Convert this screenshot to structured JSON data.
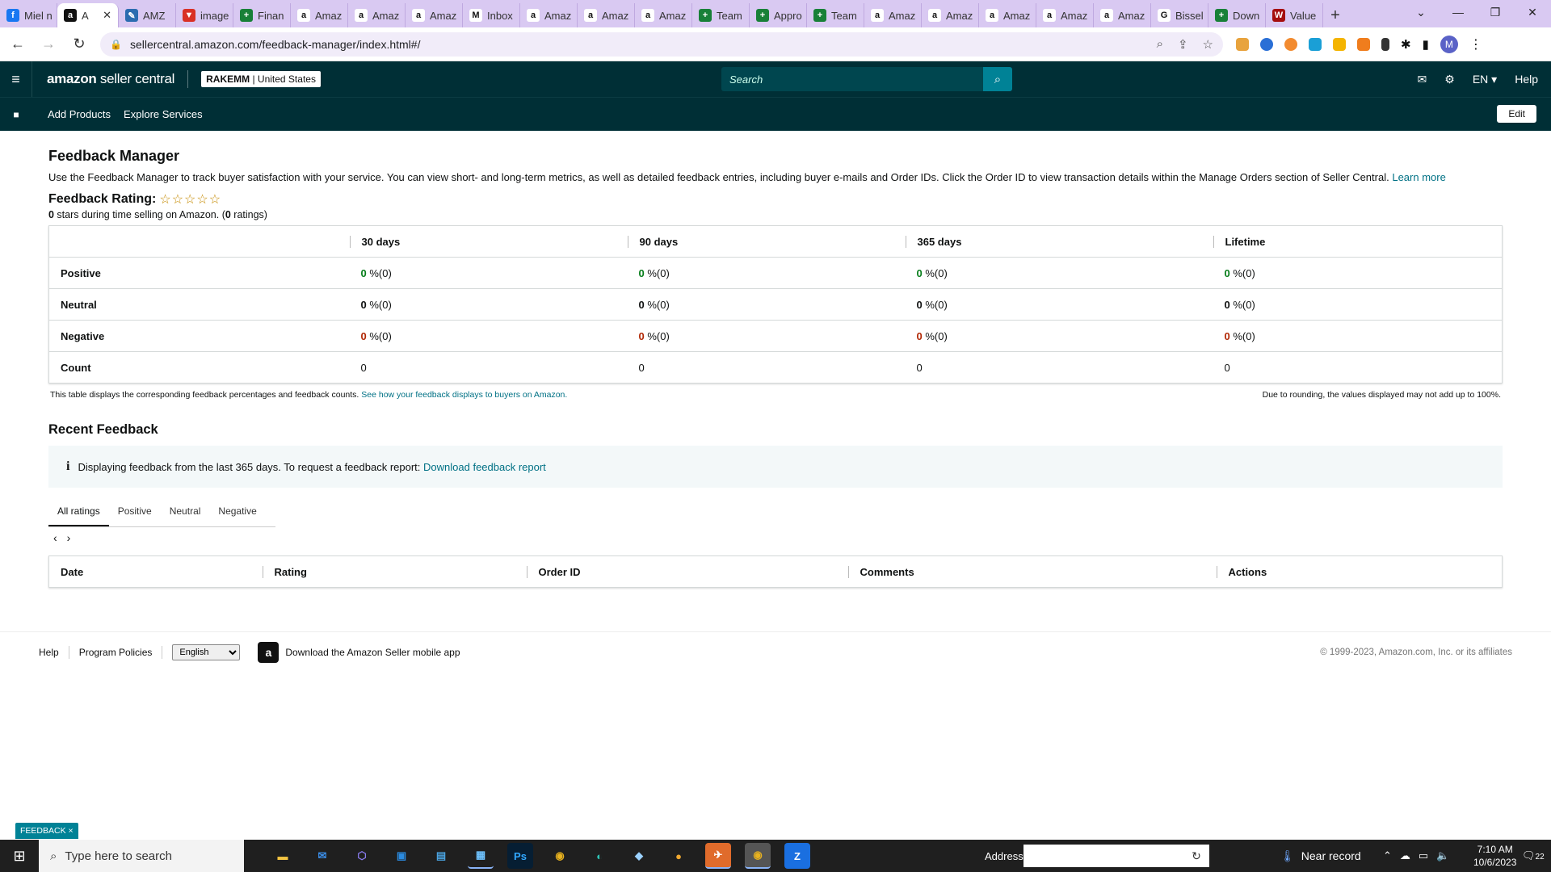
{
  "browser": {
    "tabs": [
      {
        "label": "Miel n",
        "color": "#1877f2",
        "glyph": "f",
        "active": false
      },
      {
        "label": "A",
        "color": "#111111",
        "glyph": "a",
        "active": true
      },
      {
        "label": "AMZ",
        "color": "#2b6cb0",
        "glyph": "✎",
        "active": false
      },
      {
        "label": "image",
        "color": "#d93025",
        "glyph": "▼",
        "active": false
      },
      {
        "label": "Finan",
        "color": "#188038",
        "glyph": "+",
        "active": false
      },
      {
        "label": "Amaz",
        "color": "#ffffff",
        "glyph": "a",
        "active": false
      },
      {
        "label": "Amaz",
        "color": "#ffffff",
        "glyph": "a",
        "active": false
      },
      {
        "label": "Amaz",
        "color": "#ffffff",
        "glyph": "a",
        "active": false
      },
      {
        "label": "Inbox",
        "color": "#ffffff",
        "glyph": "M",
        "active": false
      },
      {
        "label": "Amaz",
        "color": "#ffffff",
        "glyph": "a",
        "active": false
      },
      {
        "label": "Amaz",
        "color": "#ffffff",
        "glyph": "a",
        "active": false
      },
      {
        "label": "Amaz",
        "color": "#ffffff",
        "glyph": "a",
        "active": false
      },
      {
        "label": "Team",
        "color": "#188038",
        "glyph": "+",
        "active": false
      },
      {
        "label": "Appro",
        "color": "#188038",
        "glyph": "+",
        "active": false
      },
      {
        "label": "Team",
        "color": "#188038",
        "glyph": "+",
        "active": false
      },
      {
        "label": "Amaz",
        "color": "#ffffff",
        "glyph": "a",
        "active": false
      },
      {
        "label": "Amaz",
        "color": "#ffffff",
        "glyph": "a",
        "active": false
      },
      {
        "label": "Amaz",
        "color": "#ffffff",
        "glyph": "a",
        "active": false
      },
      {
        "label": "Amaz",
        "color": "#ffffff",
        "glyph": "a",
        "active": false
      },
      {
        "label": "Amaz",
        "color": "#ffffff",
        "glyph": "a",
        "active": false
      },
      {
        "label": "Bissel",
        "color": "#ffffff",
        "glyph": "G",
        "active": false
      },
      {
        "label": "Down",
        "color": "#188038",
        "glyph": "+",
        "active": false
      },
      {
        "label": "Value",
        "color": "#a50e0e",
        "glyph": "W",
        "active": false
      }
    ],
    "url": "sellercentral.amazon.com/feedback-manager/index.html#/",
    "profile_initial": "M"
  },
  "header": {
    "logo_bold": "amazon",
    "logo_rest": " seller central",
    "store_name": "RAKEMM",
    "store_region": "| United States",
    "search_placeholder": "Search",
    "lang": "EN ▾",
    "help": "Help"
  },
  "subnav": {
    "links": [
      "Add Products",
      "Explore Services"
    ],
    "edit": "Edit"
  },
  "page": {
    "title": "Feedback Manager",
    "intro": "Use the Feedback Manager to track buyer satisfaction with your service. You can view short- and long-term metrics, as well as detailed feedback entries, including buyer e-mails and Order IDs. Click the Order ID to view transaction details within the Manage Orders section of Seller Central.",
    "learn_more": "Learn more",
    "rating_label": "Feedback Rating:",
    "stars": "☆☆☆☆☆",
    "rating_stars_value": "0",
    "rating_sub_mid": " stars during time selling on Amazon. (",
    "rating_count": "0",
    "rating_sub_end": " ratings)"
  },
  "summary_table": {
    "headers": [
      "",
      "30 days",
      "90 days",
      "365 days",
      "Lifetime"
    ],
    "rows": [
      {
        "label": "Positive",
        "kind": "pos",
        "cells": [
          [
            "0",
            " %(0)"
          ],
          [
            "0",
            " %(0)"
          ],
          [
            "0",
            " %(0)"
          ],
          [
            "0",
            " %(0)"
          ]
        ]
      },
      {
        "label": "Neutral",
        "kind": "neu",
        "cells": [
          [
            "0",
            " %(0)"
          ],
          [
            "0",
            " %(0)"
          ],
          [
            "0",
            " %(0)"
          ],
          [
            "0",
            " %(0)"
          ]
        ]
      },
      {
        "label": "Negative",
        "kind": "neg",
        "cells": [
          [
            "0",
            " %(0)"
          ],
          [
            "0",
            " %(0)"
          ],
          [
            "0",
            " %(0)"
          ],
          [
            "0",
            " %(0)"
          ]
        ]
      },
      {
        "label": "Count",
        "kind": "count",
        "cells": [
          [
            "",
            "0"
          ],
          [
            "",
            "0"
          ],
          [
            "",
            "0"
          ],
          [
            "",
            "0"
          ]
        ]
      }
    ],
    "note_left": "This table displays the corresponding feedback percentages and feedback counts.",
    "note_link": "See how your feedback displays to buyers on Amazon.",
    "note_right": "Due to rounding, the values displayed may not add up to 100%."
  },
  "recent": {
    "title": "Recent Feedback",
    "info_text": "Displaying feedback from the last 365 days. To request a feedback report:",
    "info_link": "Download feedback report",
    "tabs": [
      "All ratings",
      "Positive",
      "Neutral",
      "Negative"
    ],
    "columns": [
      "Date",
      "Rating",
      "Order ID",
      "Comments",
      "Actions"
    ]
  },
  "footer": {
    "help": "Help",
    "policies": "Program Policies",
    "language": "English",
    "app_text": "Download the Amazon Seller mobile app",
    "copyright": "© 1999-2023, Amazon.com, Inc. or its affiliates",
    "feedback_tag": "FEEDBACK ×"
  },
  "taskbar": {
    "search": "Type here to search",
    "address_label": "Address",
    "weather": "Near record",
    "time": "7:10 AM",
    "date": "10/6/2023",
    "notif_count": "22"
  },
  "colors": {
    "header_bg": "#002f36",
    "accent": "#008296",
    "positive": "#067d1a",
    "negative": "#b12704",
    "link": "#007185"
  }
}
